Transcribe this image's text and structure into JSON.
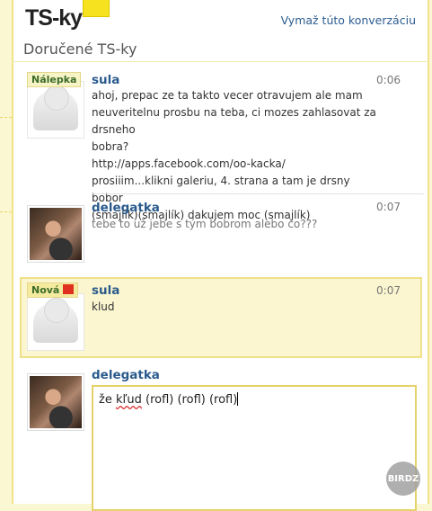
{
  "header": {
    "logo_text": "TS-ky",
    "clear_link": "Vymaž túto konverzáciu",
    "title": "Doručené TS-ky"
  },
  "messages": [
    {
      "badge": "Nálepka",
      "sender": "sula",
      "time": "0:06",
      "lines": [
        "ahoj, prepac ze ta takto vecer otravujem ale mam",
        "neuveritelnu prosbu na teba, ci mozes zahlasovat za drsneho",
        "bobra?",
        "http://apps.facebook.com/oo-kacka/",
        "prosiiim...klikni galeriu, 4. strana a tam je drsny bobor",
        "(smajlík)(smajlík) dakujem moc (smajlík)"
      ]
    },
    {
      "sender": "delegatka",
      "time": "0:07",
      "lines": [
        "tebe to už jebe s tým bobrom alebo čo???"
      ]
    },
    {
      "badge": "Nová",
      "sender": "sula",
      "time": "0:07",
      "lines": [
        "klud"
      ]
    }
  ],
  "composer": {
    "sender": "delegatka",
    "text_prefix": "že ",
    "text_word1": "kľud",
    "text_rest": " (rofl) (rofl) (rofl)"
  },
  "watermark": "BIRDZ",
  "colors": {
    "accent": "#f6e21e",
    "link": "#2a5a8c",
    "highlight": "#fbf6cf"
  }
}
